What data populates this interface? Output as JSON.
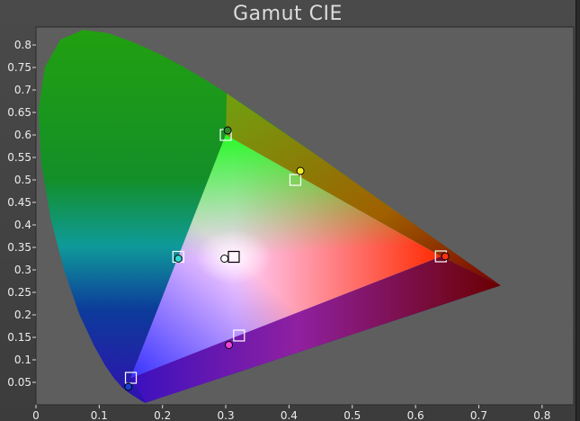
{
  "title": "Gamut CIE",
  "chart_data": {
    "type": "scatter",
    "title": "Gamut CIE",
    "xlim": [
      0,
      0.85
    ],
    "ylim": [
      0,
      0.84
    ],
    "x_ticks": [
      "0",
      "0.1",
      "0.2",
      "0.3",
      "0.4",
      "0.5",
      "0.6",
      "0.7",
      "0.8"
    ],
    "y_ticks": [
      "0.05",
      "0.1",
      "0.15",
      "0.2",
      "0.25",
      "0.3",
      "0.35",
      "0.4",
      "0.45",
      "0.5",
      "0.55",
      "0.6",
      "0.65",
      "0.7",
      "0.75",
      "0.8"
    ],
    "grid": false,
    "target_triangle": [
      [
        0.64,
        0.33
      ],
      [
        0.3,
        0.6
      ],
      [
        0.15,
        0.06
      ]
    ],
    "targets": [
      {
        "x": 0.64,
        "y": 0.33
      },
      {
        "x": 0.3,
        "y": 0.6
      },
      {
        "x": 0.15,
        "y": 0.06
      },
      {
        "x": 0.225,
        "y": 0.329
      },
      {
        "x": 0.41,
        "y": 0.5
      },
      {
        "x": 0.321,
        "y": 0.154
      },
      {
        "x": 0.3127,
        "y": 0.329
      }
    ],
    "measured": [
      {
        "x": 0.647,
        "y": 0.33,
        "color": "#ff3010"
      },
      {
        "x": 0.303,
        "y": 0.61,
        "color": "#2e8b2e"
      },
      {
        "x": 0.146,
        "y": 0.04,
        "color": "#1840d0"
      },
      {
        "x": 0.225,
        "y": 0.325,
        "color": "#30d8d0"
      },
      {
        "x": 0.418,
        "y": 0.52,
        "color": "#f0f020"
      },
      {
        "x": 0.305,
        "y": 0.133,
        "color": "#f040e0"
      },
      {
        "x": 0.298,
        "y": 0.325,
        "color": "#ffffff"
      }
    ]
  }
}
